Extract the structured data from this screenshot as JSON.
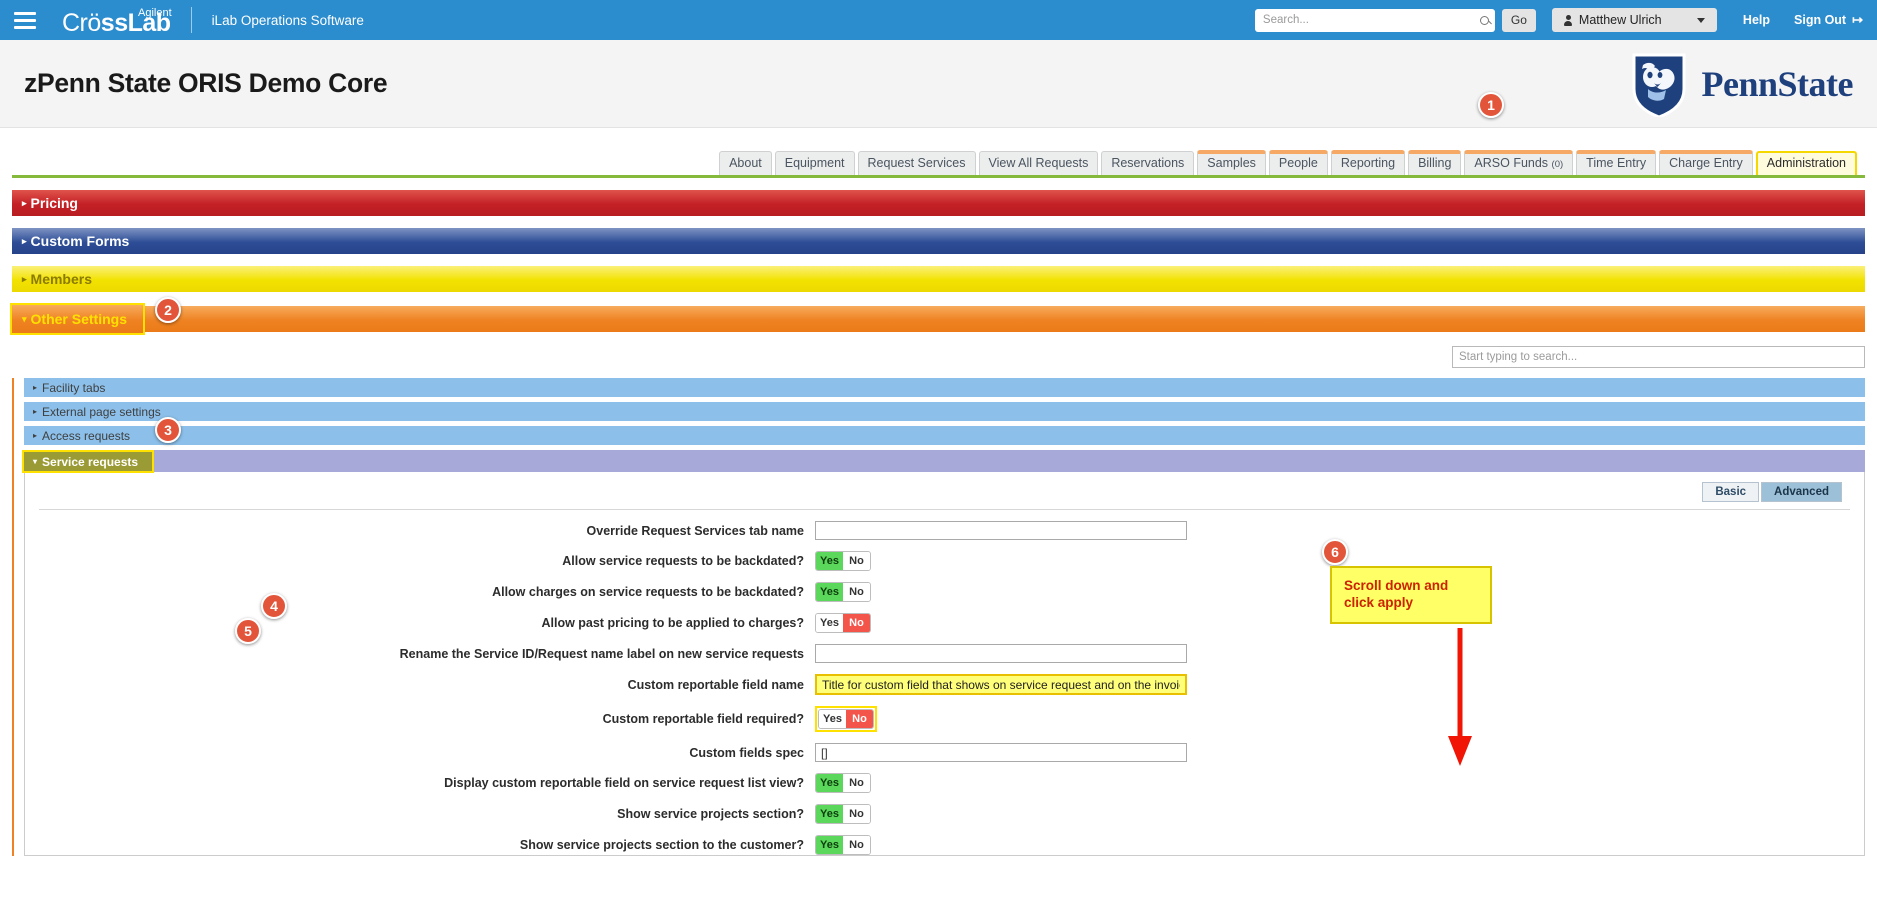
{
  "topbar": {
    "menu_icon": "hamburger-icon",
    "brand_agilent": "Agilent",
    "brand_cross": "CrossLab",
    "brand_cross_part1": "Cr",
    "brand_cross_part2": "ssLab",
    "tagline": "iLab Operations Software",
    "search_placeholder": "Search...",
    "search_value": "",
    "go_label": "Go",
    "user_name": "Matthew Ulrich",
    "help_label": "Help",
    "signout_label": "Sign Out",
    "signout_glyph": "↦"
  },
  "header": {
    "page_title": "zPenn State ORIS Demo Core",
    "logo_text": "PennState"
  },
  "tabs": [
    {
      "label": "About",
      "orange_top": false,
      "active": false
    },
    {
      "label": "Equipment",
      "orange_top": false,
      "active": false
    },
    {
      "label": "Request Services",
      "orange_top": false,
      "active": false
    },
    {
      "label": "View All Requests",
      "orange_top": false,
      "active": false
    },
    {
      "label": "Reservations",
      "orange_top": false,
      "active": false
    },
    {
      "label": "Samples",
      "orange_top": true,
      "active": false
    },
    {
      "label": "People",
      "orange_top": true,
      "active": false
    },
    {
      "label": "Reporting",
      "orange_top": true,
      "active": false
    },
    {
      "label": "Billing",
      "orange_top": true,
      "active": false
    },
    {
      "label": "ARSO Funds",
      "suffix": "(0)",
      "orange_top": true,
      "active": false
    },
    {
      "label": "Time Entry",
      "orange_top": true,
      "active": false
    },
    {
      "label": "Charge Entry",
      "orange_top": true,
      "active": false
    },
    {
      "label": "Administration",
      "orange_top": false,
      "active": true
    }
  ],
  "accordions": [
    {
      "label": "Pricing",
      "arrow": "▸",
      "expanded": false
    },
    {
      "label": "Custom Forms",
      "arrow": "▸",
      "expanded": false
    },
    {
      "label": "Members",
      "arrow": "▸",
      "expanded": false
    },
    {
      "label": "Other Settings",
      "arrow": "▾",
      "expanded": true
    }
  ],
  "other_settings": {
    "search_placeholder": "Start typing to search...",
    "search_value": "",
    "subsections": [
      {
        "label": "Facility tabs",
        "arrow": "▸",
        "expanded": false
      },
      {
        "label": "External page settings",
        "arrow": "▸",
        "expanded": false
      },
      {
        "label": "Access requests",
        "arrow": "▸",
        "expanded": false
      },
      {
        "label": "Service requests",
        "arrow": "▾",
        "expanded": true
      }
    ]
  },
  "view_toggle": {
    "basic": "Basic",
    "advanced": "Advanced",
    "selected": "Advanced"
  },
  "form_rows": [
    {
      "label": "Override Request Services tab name",
      "type": "text",
      "value": "",
      "highlight": false
    },
    {
      "label": "Allow service requests to be backdated?",
      "type": "toggle",
      "value": "Yes",
      "highlight": false
    },
    {
      "label": "Allow charges on service requests to be backdated?",
      "type": "toggle",
      "value": "Yes",
      "highlight": false
    },
    {
      "label": "Allow past pricing to be applied to charges?",
      "type": "toggle",
      "value": "No",
      "highlight": false
    },
    {
      "label": "Rename the Service ID/Request name label on new service requests",
      "type": "text",
      "value": "",
      "highlight": false
    },
    {
      "label": "Custom reportable field name",
      "type": "text",
      "value": "Title for custom field that shows on service request and on the invoice",
      "highlight": true
    },
    {
      "label": "Custom reportable field required?",
      "type": "toggle",
      "value": "No",
      "highlight": true
    },
    {
      "label": "Custom fields spec",
      "type": "text",
      "value": "[]",
      "highlight": false
    },
    {
      "label": "Display custom reportable field on service request list view?",
      "type": "toggle",
      "value": "Yes",
      "highlight": false
    },
    {
      "label": "Show service projects section?",
      "type": "toggle",
      "value": "Yes",
      "highlight": false
    },
    {
      "label": "Show service projects section to the customer?",
      "type": "toggle",
      "value": "Yes",
      "highlight": false
    }
  ],
  "toggle_labels": {
    "yes": "Yes",
    "no": "No"
  },
  "callouts": [
    {
      "number": "1"
    },
    {
      "number": "2"
    },
    {
      "number": "3"
    },
    {
      "number": "4"
    },
    {
      "number": "5"
    },
    {
      "number": "6"
    }
  ],
  "annotation": {
    "text": "Scroll down and click apply"
  },
  "colors": {
    "topbar_blue": "#2b8cce",
    "pricing_red": "#c32025",
    "forms_blue": "#2d4d96",
    "members_yellow": "#f2e200",
    "other_orange": "#ef8222",
    "sub_blue": "#8cc0ea",
    "sub_purple": "#a7a9d9",
    "callout_orange": "#e2553a",
    "highlight_yellow": "#ffff66",
    "pennstate_navy": "#1e407c",
    "toggle_yes_green": "#5bd75b",
    "toggle_no_red": "#f4554a",
    "tab_orange_top": "#f5a964",
    "active_tab_yellow": "#f5d800"
  }
}
